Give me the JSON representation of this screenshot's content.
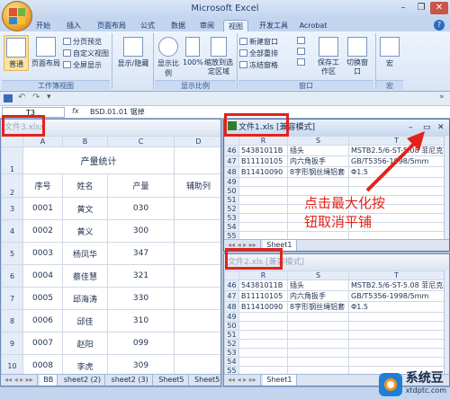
{
  "app": {
    "title": "Microsoft Excel"
  },
  "tabs": [
    {
      "label": "开始"
    },
    {
      "label": "插入"
    },
    {
      "label": "页面布局"
    },
    {
      "label": "公式"
    },
    {
      "label": "数据"
    },
    {
      "label": "审阅"
    },
    {
      "label": "视图"
    },
    {
      "label": "开发工具"
    },
    {
      "label": "Acrobat"
    }
  ],
  "ribbon": {
    "workbook_views": {
      "label": "工作簿视图",
      "normal": "普通",
      "page_layout": "页面布局",
      "page_break": "分页预览",
      "custom": "自定义视图",
      "fullscreen": "全屏显示"
    },
    "show_hide": {
      "label": "显示/隐藏"
    },
    "zoom": {
      "label": "显示比例",
      "zoom": "显示比例",
      "hundred": "100%",
      "zoom_selection": "缩放到选定区域"
    },
    "window": {
      "label": "窗口",
      "new_window": "新建窗口",
      "arrange_all": "全部重排",
      "freeze": "冻结窗格",
      "save_workspace": "保存工作区",
      "switch_windows": "切换窗口"
    },
    "macro": {
      "label": "宏",
      "macro": "宏"
    }
  },
  "formula_bar": {
    "name_box": "T3",
    "fx": "fx",
    "content": "BSD.01.01 锯掉"
  },
  "colors": {
    "annotation_red": "#e2231a",
    "brand_orange": "#f7941d"
  },
  "win3": {
    "title": "文件3.xlsx",
    "columns": [
      "",
      "A",
      "B",
      "C",
      "D"
    ],
    "title_row": "产量统计",
    "header": [
      "序号",
      "姓名",
      "产量",
      "辅助列"
    ],
    "rows": [
      {
        "num": "3",
        "id": "0001",
        "name": "黄文",
        "qty": "030"
      },
      {
        "num": "4",
        "id": "0002",
        "name": "黄义",
        "qty": "300"
      },
      {
        "num": "5",
        "id": "0003",
        "name": "杨凤华",
        "qty": "347"
      },
      {
        "num": "6",
        "id": "0004",
        "name": "蔡佳慧",
        "qty": "321"
      },
      {
        "num": "7",
        "id": "0005",
        "name": "邱海涛",
        "qty": "330"
      },
      {
        "num": "8",
        "id": "0006",
        "name": "邱佳",
        "qty": "310"
      },
      {
        "num": "9",
        "id": "0007",
        "name": "赵阳",
        "qty": "099"
      },
      {
        "num": "10",
        "id": "0008",
        "name": "李虎",
        "qty": "309"
      }
    ],
    "row_nums_top": [
      "1",
      "2"
    ],
    "sheet_tabs": [
      "BB",
      "sheet2 (2)",
      "sheet2 (3)",
      "Sheet5",
      "Sheet5"
    ]
  },
  "win1": {
    "title": "文件1.xls",
    "mode": "[兼容模式]",
    "columns": [
      "",
      "R",
      "S",
      "T"
    ],
    "rows": [
      {
        "num": "46",
        "r": "54381011B",
        "s": "插头",
        "t": "MSTB2.5/6-ST-5.08 菲尼克斯"
      },
      {
        "num": "47",
        "r": "B11110105",
        "s": "内六角扳手",
        "t": "GB/T5356-1998/5mm"
      },
      {
        "num": "48",
        "r": "B11410090",
        "s": "8字形钢丝绳铝套",
        "t": "Φ1.5"
      },
      {
        "num": "49",
        "r": "",
        "s": "",
        "t": ""
      },
      {
        "num": "50",
        "r": "",
        "s": "",
        "t": ""
      },
      {
        "num": "51",
        "r": "",
        "s": "",
        "t": ""
      },
      {
        "num": "52",
        "r": "",
        "s": "",
        "t": ""
      },
      {
        "num": "53",
        "r": "",
        "s": "",
        "t": ""
      },
      {
        "num": "54",
        "r": "",
        "s": "",
        "t": ""
      },
      {
        "num": "55",
        "r": "",
        "s": "",
        "t": ""
      },
      {
        "num": "56",
        "r": "",
        "s": "",
        "t": ""
      }
    ],
    "sheet_tab": "Sheet1"
  },
  "win2": {
    "title": "文件2.xls",
    "mode": "[兼容模式]",
    "columns": [
      "",
      "R",
      "S",
      "T"
    ],
    "rows": [
      {
        "num": "46",
        "r": "54381011B",
        "s": "插头",
        "t": "MSTB2.5/6-ST-5.08 菲尼克斯"
      },
      {
        "num": "47",
        "r": "B11110105",
        "s": "内六角扳手",
        "t": "GB/T5356-1998/5mm"
      },
      {
        "num": "48",
        "r": "B11410090",
        "s": "8字形钢丝绳铝套",
        "t": "Φ1.5"
      },
      {
        "num": "49",
        "r": "",
        "s": "",
        "t": ""
      },
      {
        "num": "50",
        "r": "",
        "s": "",
        "t": ""
      },
      {
        "num": "51",
        "r": "",
        "s": "",
        "t": ""
      },
      {
        "num": "52",
        "r": "",
        "s": "",
        "t": ""
      },
      {
        "num": "53",
        "r": "",
        "s": "",
        "t": ""
      },
      {
        "num": "54",
        "r": "",
        "s": "",
        "t": ""
      },
      {
        "num": "55",
        "r": "",
        "s": "",
        "t": ""
      }
    ],
    "sheet_tab": "Sheet1"
  },
  "annotation": {
    "line1": "点击最大化按",
    "line2": "钮取消平铺"
  },
  "watermark": {
    "name": "系统豆",
    "url": "xtdptc.com"
  }
}
